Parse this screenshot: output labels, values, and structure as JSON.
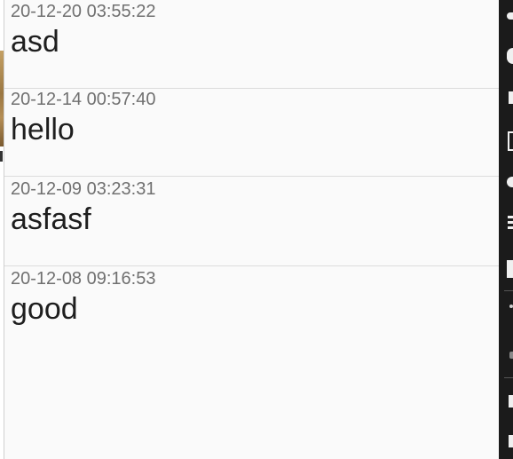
{
  "messages": [
    {
      "time": "20-12-20 03:55:22",
      "text": "asd"
    },
    {
      "time": "20-12-14 00:57:40",
      "text": "hello"
    },
    {
      "time": "20-12-09 03:23:31",
      "text": "asfasf"
    },
    {
      "time": "20-12-08 09:16:53",
      "text": "good"
    }
  ],
  "colors": {
    "background": "#fafafa",
    "timestamp": "#707070",
    "message": "#1e1e1e",
    "divider": "#dcdcdc",
    "side_panel": "#1b1b1b"
  }
}
